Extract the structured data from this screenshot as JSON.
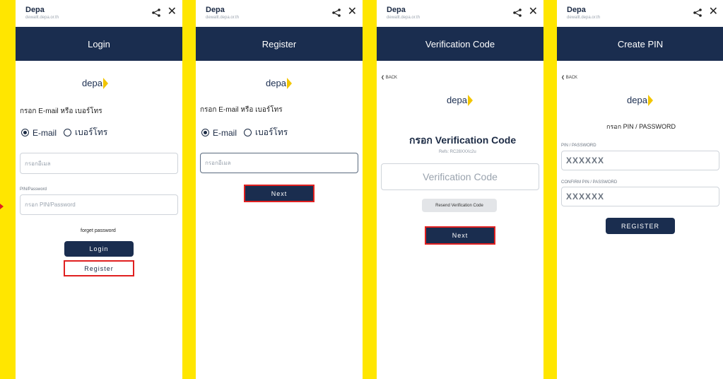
{
  "app": {
    "name": "Depa",
    "url": "dewallt.depa.or.th"
  },
  "logo_text": "depa",
  "screens": {
    "login": {
      "title": "Login",
      "prompt": "กรอก E-mail หรือ เบอร์โทร",
      "radio_email": "E-mail",
      "radio_phone": "เบอร์โทร",
      "email_placeholder": "กรอกอีเมล",
      "pin_label": "PIN/Password",
      "pin_placeholder": "กรอก PIN/Password",
      "forget": "forget password",
      "login_button": "Login",
      "register_button": "Register"
    },
    "register": {
      "title": "Register",
      "prompt": "กรอก E-mail หรือ เบอร์โทร",
      "radio_email": "E-mail",
      "radio_phone": "เบอร์โทร",
      "email_placeholder": "กรอกอีเมล",
      "next_button": "Next"
    },
    "verify": {
      "title": "Verification Code",
      "back": "BACK",
      "heading": "กรอก Verification Code",
      "refs": "Refs: RC28XXXc2u",
      "code_placeholder": "Verification Code",
      "resend_button": "Resend Verification Code",
      "next_button": "Next"
    },
    "pin": {
      "title": "Create PIN",
      "back": "BACK",
      "heading": "กรอก PIN / PASSWORD",
      "pin_label": "PIN / PASSWORD",
      "pin_value": "XXXXXX",
      "confirm_label": "CONFIRM PIN / PASSWORD",
      "confirm_value": "XXXXXX",
      "register_button": "REGISTER"
    }
  }
}
